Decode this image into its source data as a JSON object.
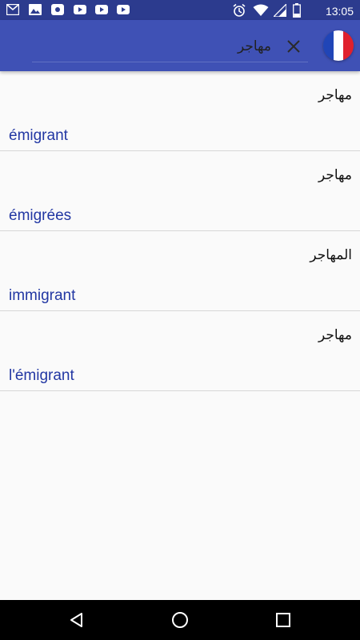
{
  "status_bar": {
    "time": "13:05",
    "left_icons": [
      "gmail-icon",
      "photos-icon",
      "app-icon",
      "youtube-icon",
      "youtube-icon",
      "youtube-icon"
    ],
    "right_icons": [
      "alarm-icon",
      "wifi-icon",
      "signal-icon",
      "battery-icon"
    ]
  },
  "toolbar": {
    "search_value": "مهاجر",
    "clear_icon": "close-icon",
    "language_flag": "france-flag-icon"
  },
  "results": [
    {
      "source": "مهاجر",
      "target": "émigrant"
    },
    {
      "source": "مهاجر",
      "target": "émigrées"
    },
    {
      "source": "المهاجر",
      "target": "immigrant"
    },
    {
      "source": "مهاجر",
      "target": "l'émigrant"
    }
  ],
  "nav_bar": {
    "icons": [
      "back-icon",
      "home-icon",
      "recents-icon"
    ]
  },
  "colors": {
    "status_bar": "#2c3b8e",
    "toolbar": "#3f51b5",
    "link": "#2237a3",
    "background": "#fafafa",
    "divider": "#d6d6d6"
  }
}
